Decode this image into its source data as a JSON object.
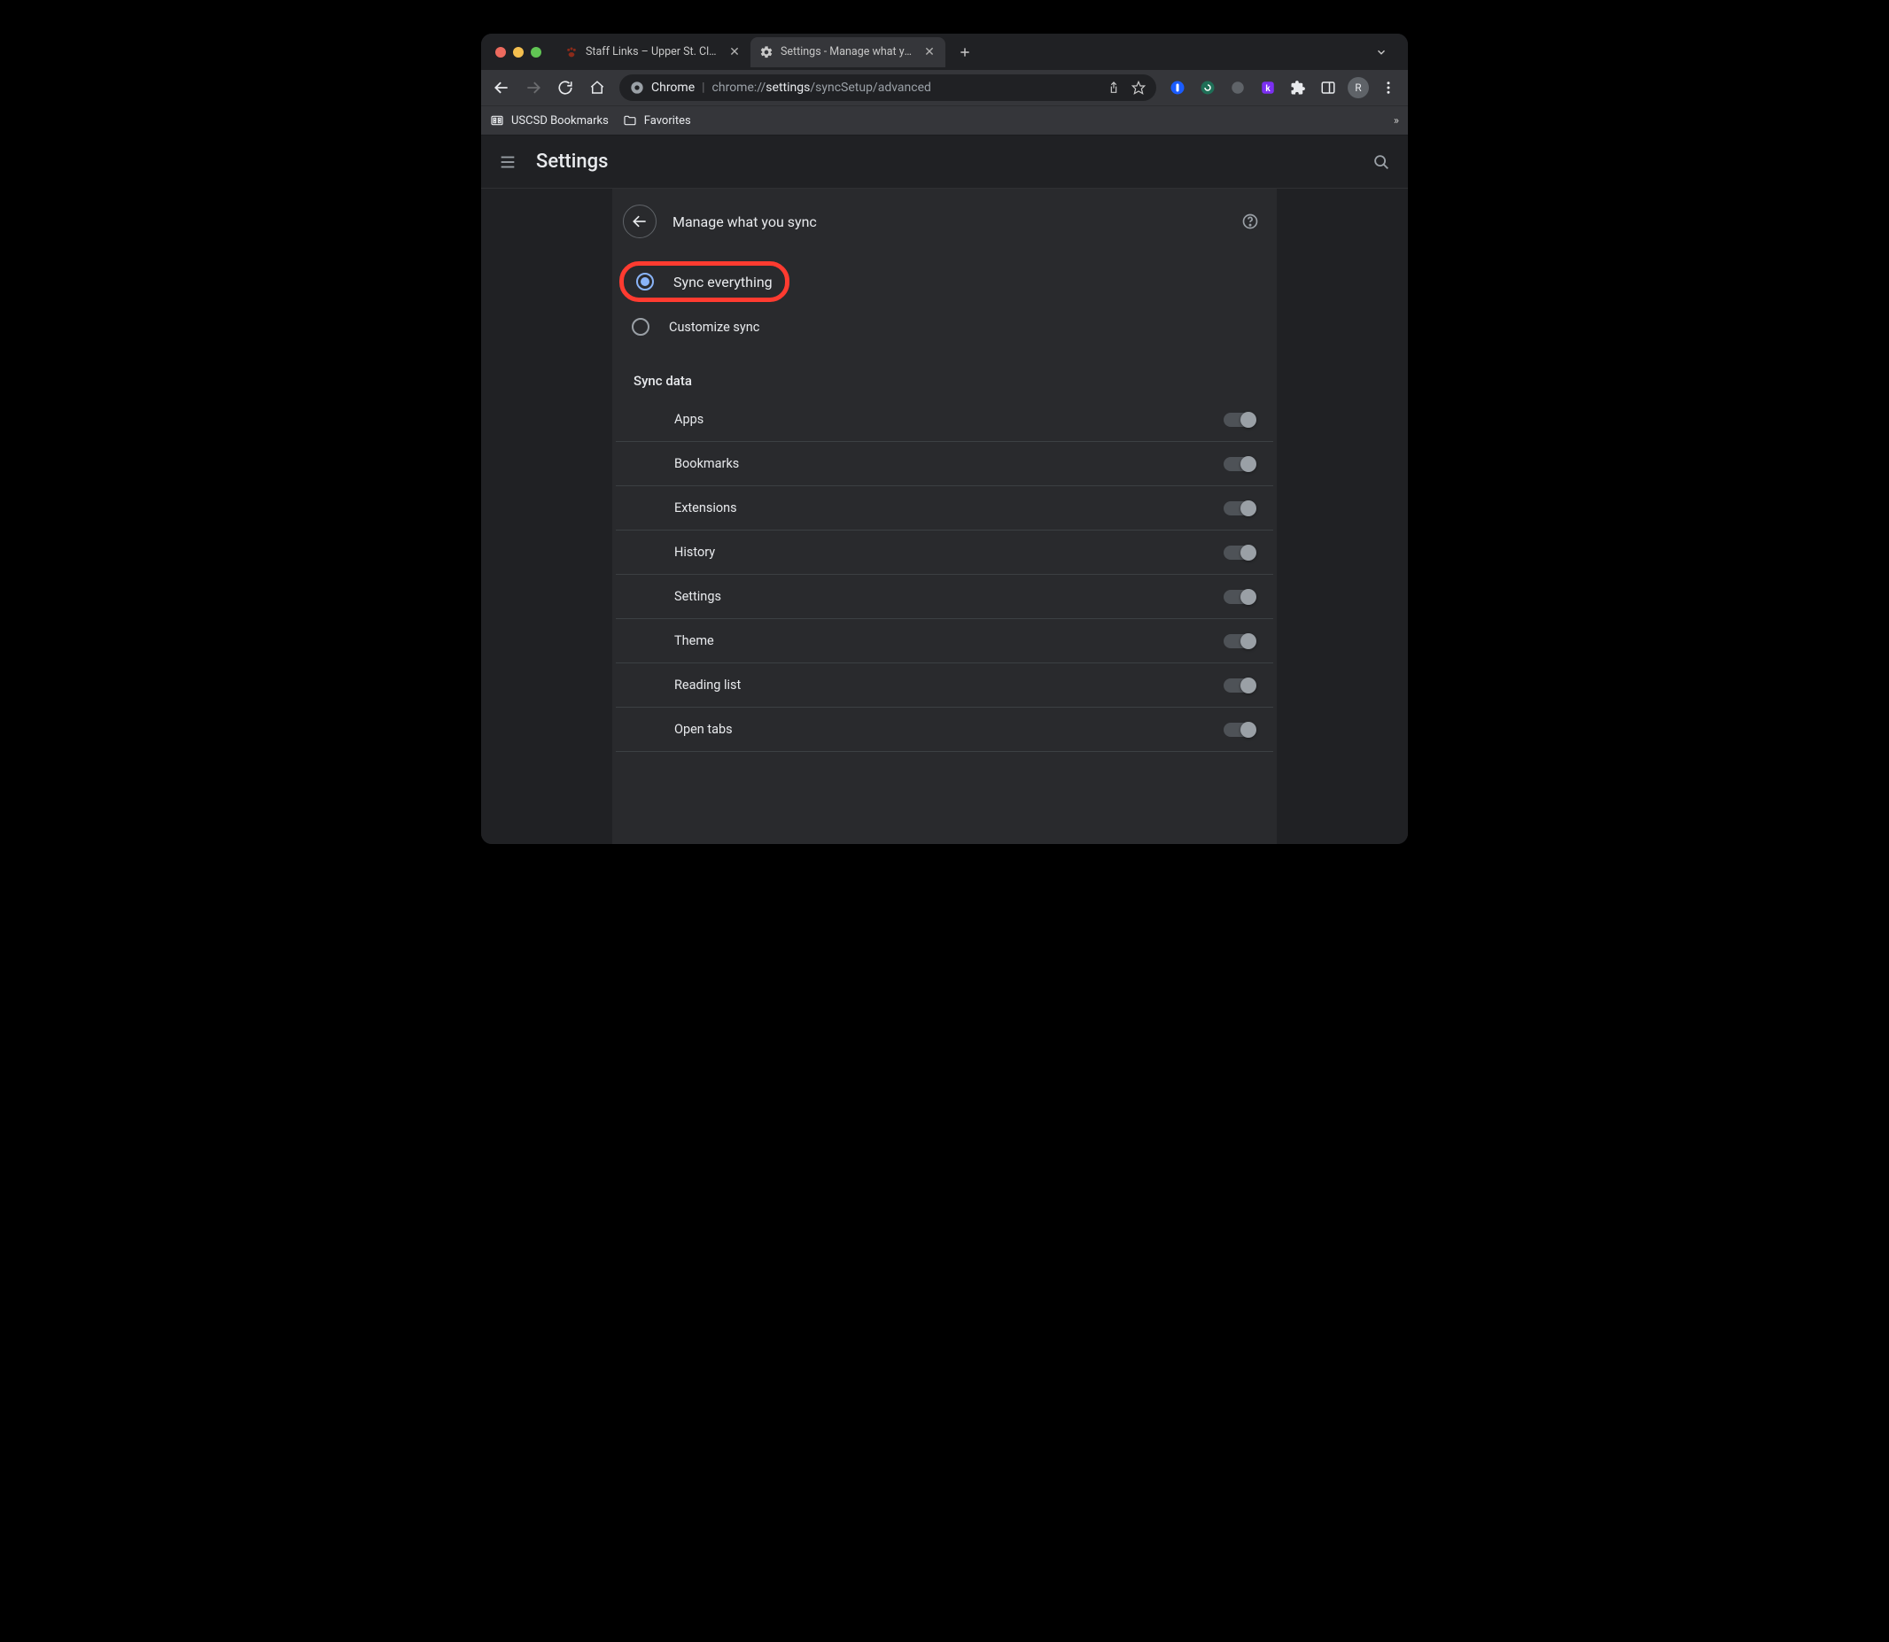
{
  "tabs": [
    {
      "title": "Staff Links – Upper St. Clair S…",
      "active": false
    },
    {
      "title": "Settings - Manage what you s…",
      "active": true
    }
  ],
  "omnibox": {
    "label": "Chrome",
    "url_prefix": "chrome://",
    "url_hl": "settings",
    "url_suffix": "/syncSetup/advanced"
  },
  "bookmarks": [
    {
      "label": "USCSD Bookmarks"
    },
    {
      "label": "Favorites"
    }
  ],
  "avatar_initial": "R",
  "settings_header": "Settings",
  "panel": {
    "title": "Manage what you sync",
    "radios": [
      {
        "label": "Sync everything",
        "selected": true,
        "highlighted": true
      },
      {
        "label": "Customize sync",
        "selected": false,
        "highlighted": false
      }
    ],
    "section_title": "Sync data",
    "toggles": [
      {
        "label": "Apps",
        "on": true
      },
      {
        "label": "Bookmarks",
        "on": true
      },
      {
        "label": "Extensions",
        "on": true
      },
      {
        "label": "History",
        "on": true
      },
      {
        "label": "Settings",
        "on": true
      },
      {
        "label": "Theme",
        "on": true
      },
      {
        "label": "Reading list",
        "on": true
      },
      {
        "label": "Open tabs",
        "on": true
      }
    ]
  }
}
